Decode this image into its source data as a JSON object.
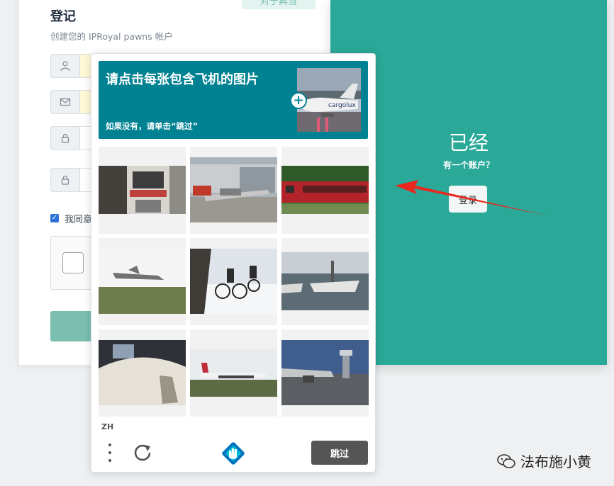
{
  "register": {
    "title": "登记",
    "subtitle": "创建您的 IPRoyal pawns 帐户",
    "about_label": "对于典当",
    "agree_text": "我同意"
  },
  "teal": {
    "heading": "已经",
    "subheading": "有一个账户？",
    "login_label": "登录"
  },
  "captcha": {
    "prompt": "请点击每张包含飞机的图片",
    "hint": "如果没有，请单击“跳过”",
    "example_text": "cargolux",
    "lang": "ZH",
    "skip_label": "跳过"
  },
  "watermark": {
    "text": "法布施小黄"
  },
  "colors": {
    "teal": "#2aa898",
    "captcha_header": "#008293",
    "skip": "#555555"
  }
}
